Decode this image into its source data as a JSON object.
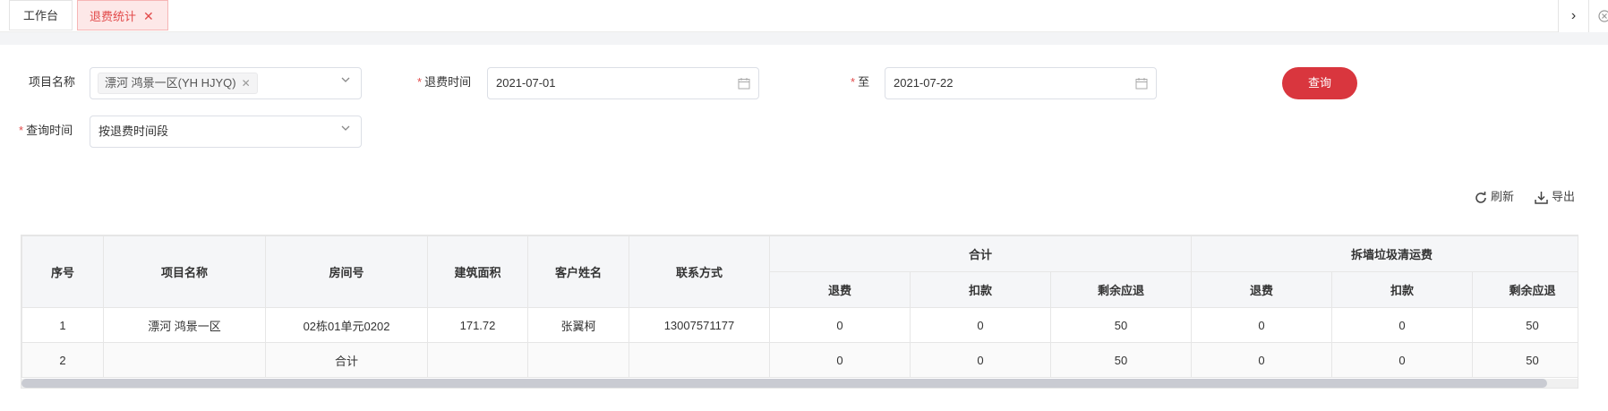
{
  "tabs": [
    {
      "label": "工作台",
      "active": false
    },
    {
      "label": "退费统计",
      "active": true
    }
  ],
  "icons": {
    "tab_close": "close-icon",
    "next": "chevron-right-icon",
    "close_all": "close-circle-icon"
  },
  "form": {
    "project_label": "项目名称",
    "project_tag": "漂河 鸿景一区(YH HJYQ)",
    "refund_time_label": "退费时间",
    "date_start": "2021-07-01",
    "to_label": "至",
    "date_end": "2021-07-22",
    "query_button": "查询",
    "query_time_label": "查询时间",
    "query_time_value": "按退费时间段"
  },
  "toolbar": {
    "refresh": "刷新",
    "export": "导出"
  },
  "table": {
    "headers": {
      "index": "序号",
      "project": "项目名称",
      "room": "房间号",
      "area": "建筑面积",
      "customer": "客户姓名",
      "contact": "联系方式",
      "group_total": "合计",
      "group_demolition": "拆墙垃圾清运费",
      "refund": "退费",
      "deduction": "扣款",
      "remaining": "剩余应退"
    },
    "rows": [
      {
        "index": "1",
        "project": "漂河 鸿景一区",
        "room": "02栋01单元0202",
        "area": "171.72",
        "customer": "张翼柯",
        "contact": "13007571177",
        "t_refund": "0",
        "t_deduct": "0",
        "t_remain": "50",
        "d_refund": "0",
        "d_deduct": "0",
        "d_remain": "50"
      },
      {
        "index": "2",
        "project": "",
        "room": "合计",
        "area": "",
        "customer": "",
        "contact": "",
        "t_refund": "0",
        "t_deduct": "0",
        "t_remain": "50",
        "d_refund": "0",
        "d_deduct": "0",
        "d_remain": "50"
      }
    ]
  },
  "colors": {
    "accent": "#d9363e",
    "active_tab_bg": "#fde8e8",
    "header_bg": "#f5f6f8"
  }
}
